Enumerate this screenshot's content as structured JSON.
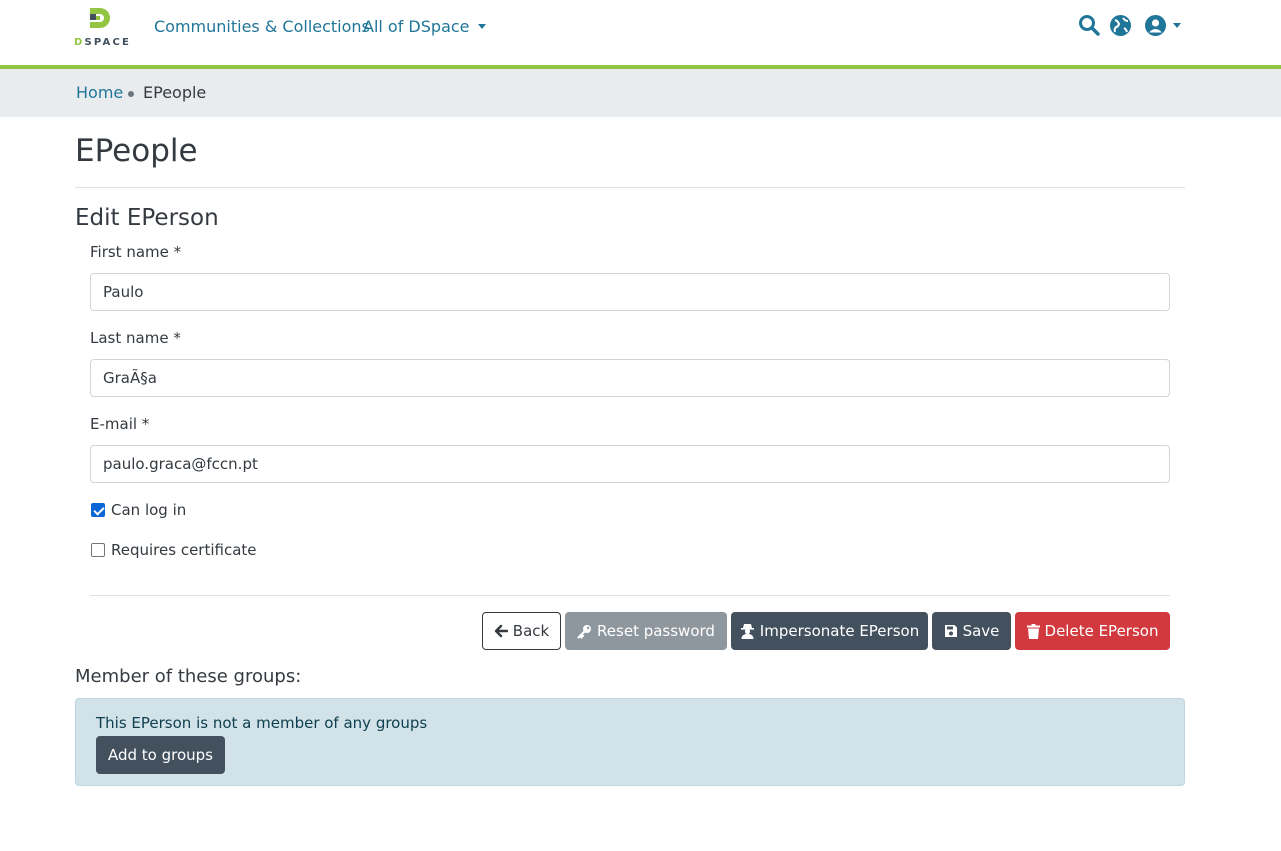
{
  "header": {
    "logo_text_d": "D",
    "logo_text_rest": "SPACE",
    "nav": [
      {
        "label": "Communities & Collections"
      },
      {
        "label": "All of DSpace"
      }
    ],
    "icons": [
      "search-icon",
      "globe-icon",
      "user-circle-icon"
    ]
  },
  "breadcrumb": {
    "home": "Home",
    "current": "EPeople"
  },
  "page": {
    "title": "EPeople",
    "section_title": "Edit EPerson"
  },
  "form": {
    "first_name_label": "First name *",
    "first_name_value": "Paulo",
    "last_name_label": "Last name *",
    "last_name_value": "GraÃ§a",
    "email_label": "E-mail *",
    "email_value": "paulo.graca@fccn.pt",
    "can_log_in_label": "Can log in",
    "can_log_in_checked": true,
    "requires_cert_label": "Requires certificate",
    "requires_cert_checked": false
  },
  "actions": {
    "back": "Back",
    "reset_password": "Reset password",
    "impersonate": "Impersonate EPerson",
    "save": "Save",
    "delete": "Delete EPerson"
  },
  "groups": {
    "title": "Member of these groups:",
    "empty_message": "This EPerson is not a member of any groups",
    "add_button": "Add to groups"
  },
  "colors": {
    "accent_green": "#92c642",
    "link_blue": "#207698",
    "dark_button": "#43515f",
    "danger": "#d2393e",
    "info_bg": "#d1e2e9"
  }
}
